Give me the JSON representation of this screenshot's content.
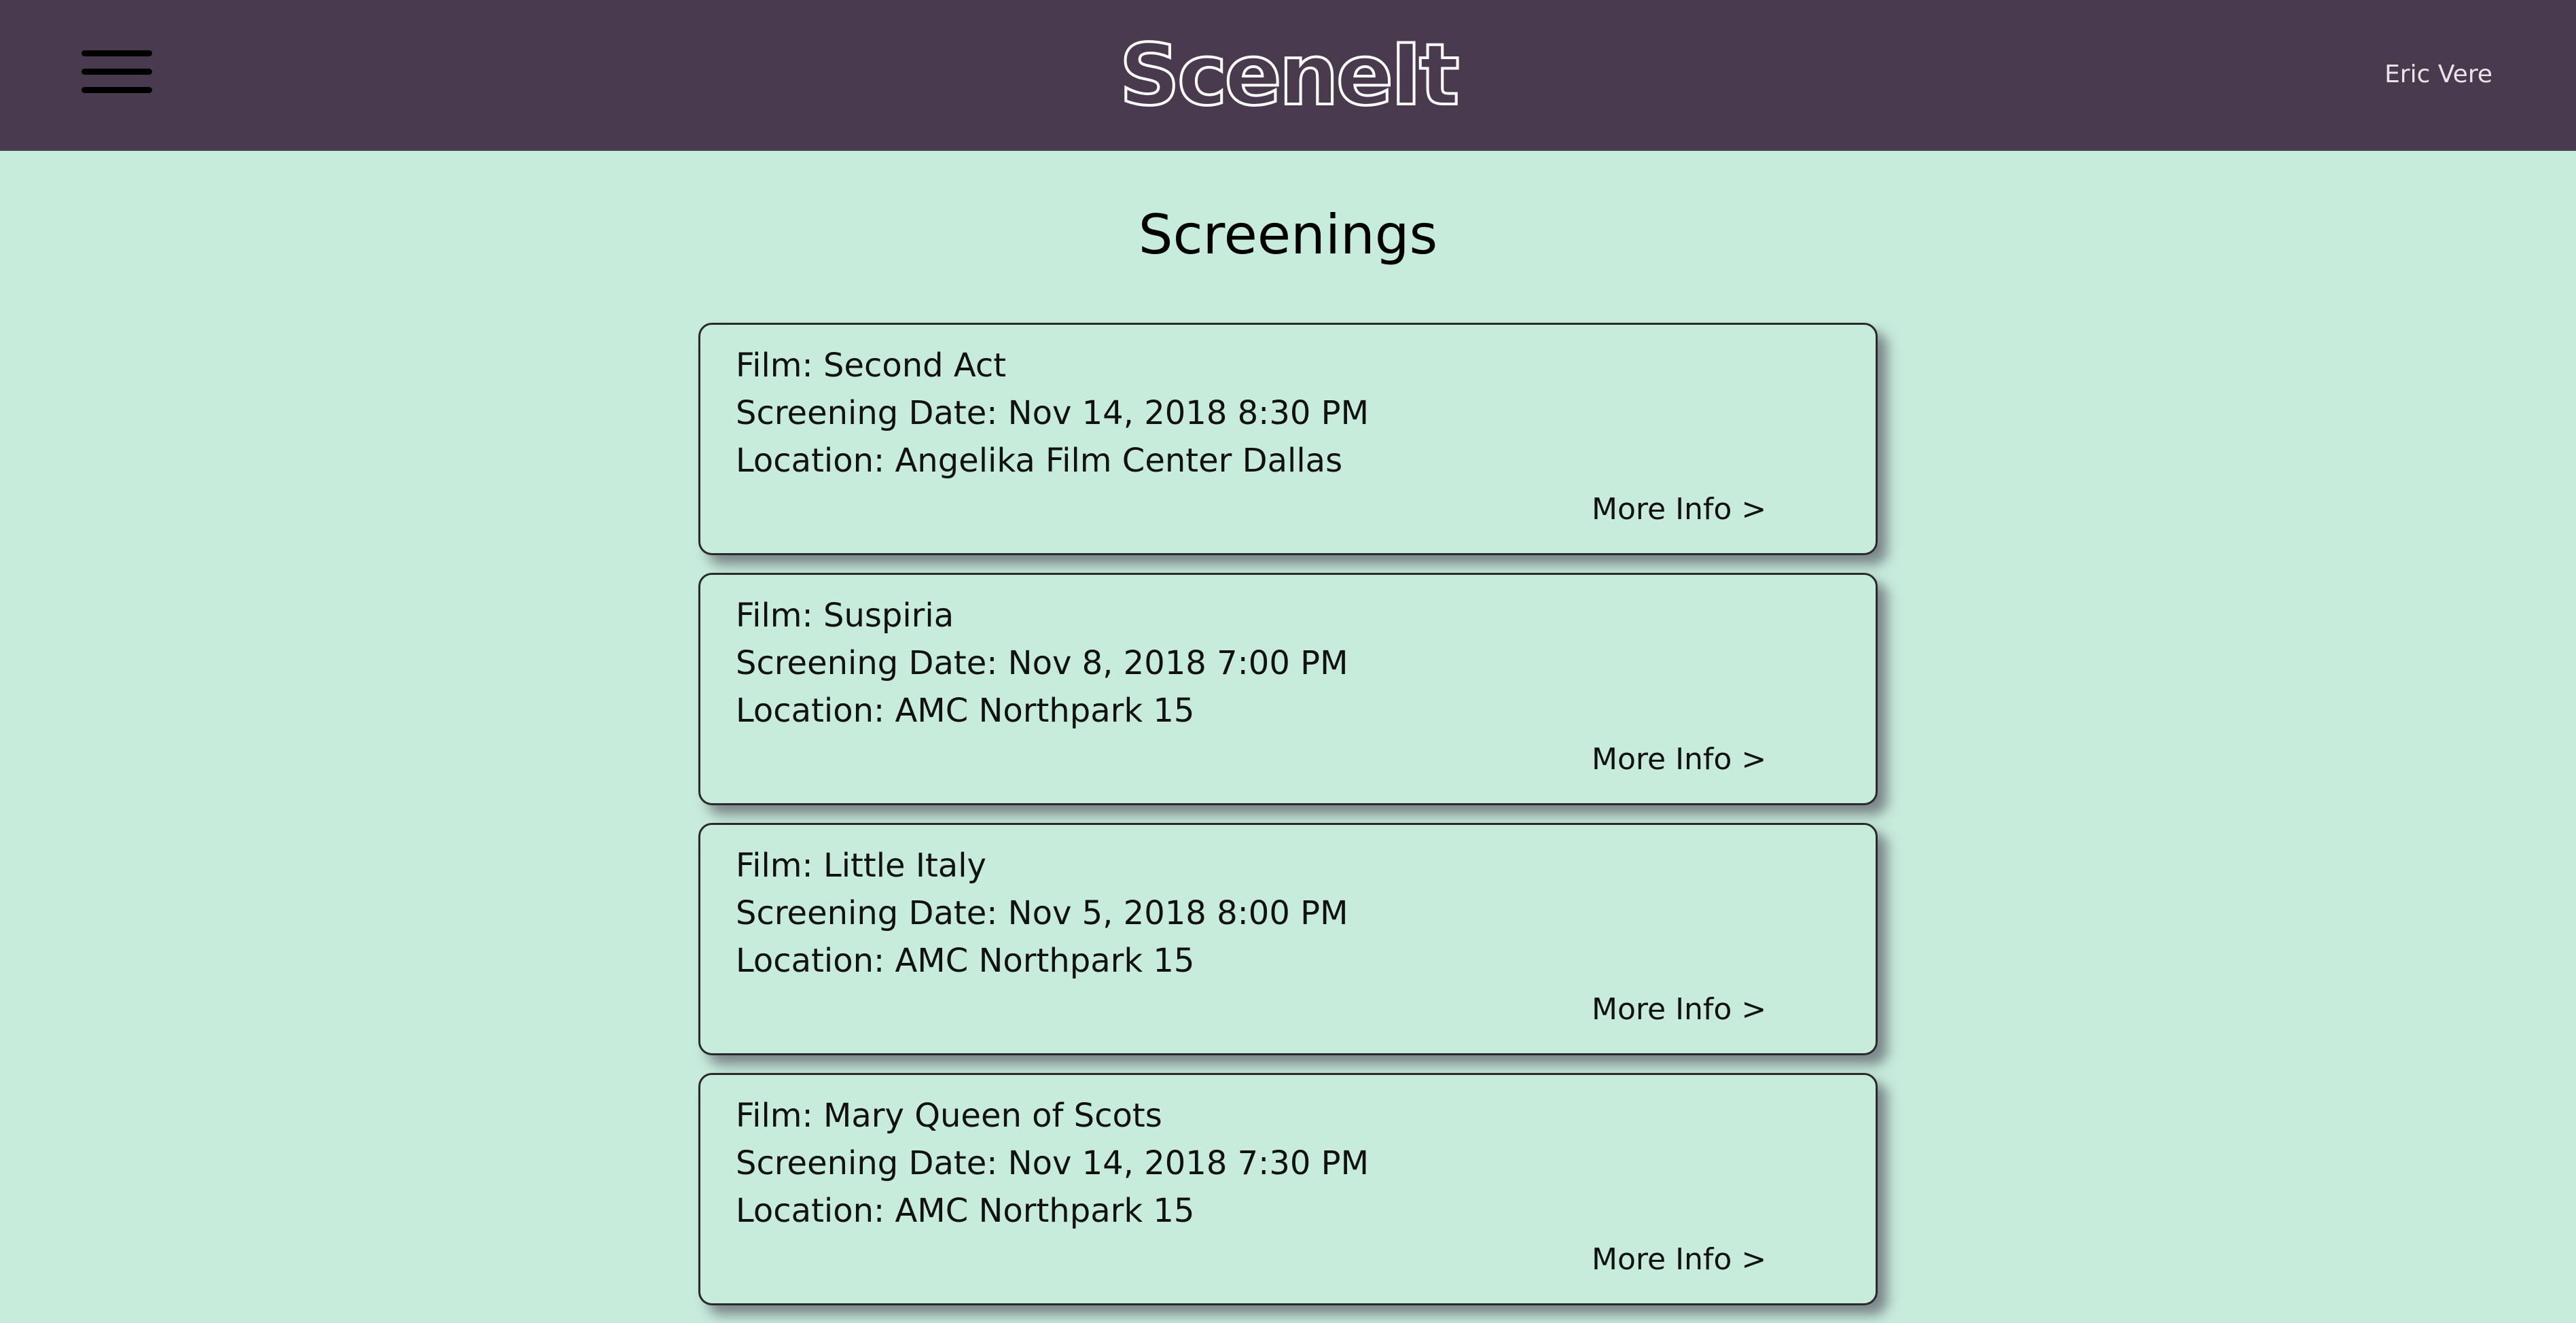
{
  "header": {
    "logo": "SceneIt",
    "user_name": "Eric Vere",
    "menu_icon": "hamburger-menu-icon"
  },
  "page": {
    "title": "Screenings"
  },
  "screenings": [
    {
      "film": "Film: Second Act",
      "date": "Screening Date: Nov 14, 2018 8:30 PM",
      "location": "Location: Angelika Film Center Dallas",
      "more": "More Info >"
    },
    {
      "film": "Film: Suspiria",
      "date": "Screening Date: Nov 8, 2018 7:00 PM",
      "location": "Location: AMC Northpark 15",
      "more": "More Info >"
    },
    {
      "film": "Film: Little Italy",
      "date": "Screening Date: Nov 5, 2018 8:00 PM",
      "location": "Location: AMC Northpark 15",
      "more": "More Info >"
    },
    {
      "film": "Film: Mary Queen of Scots",
      "date": "Screening Date: Nov 14, 2018 7:30 PM",
      "location": "Location: AMC Northpark 15",
      "more": "More Info >"
    }
  ],
  "colors": {
    "header_bg": "#4a3a4e",
    "page_bg": "#c7ecdc",
    "text": "#111111"
  }
}
